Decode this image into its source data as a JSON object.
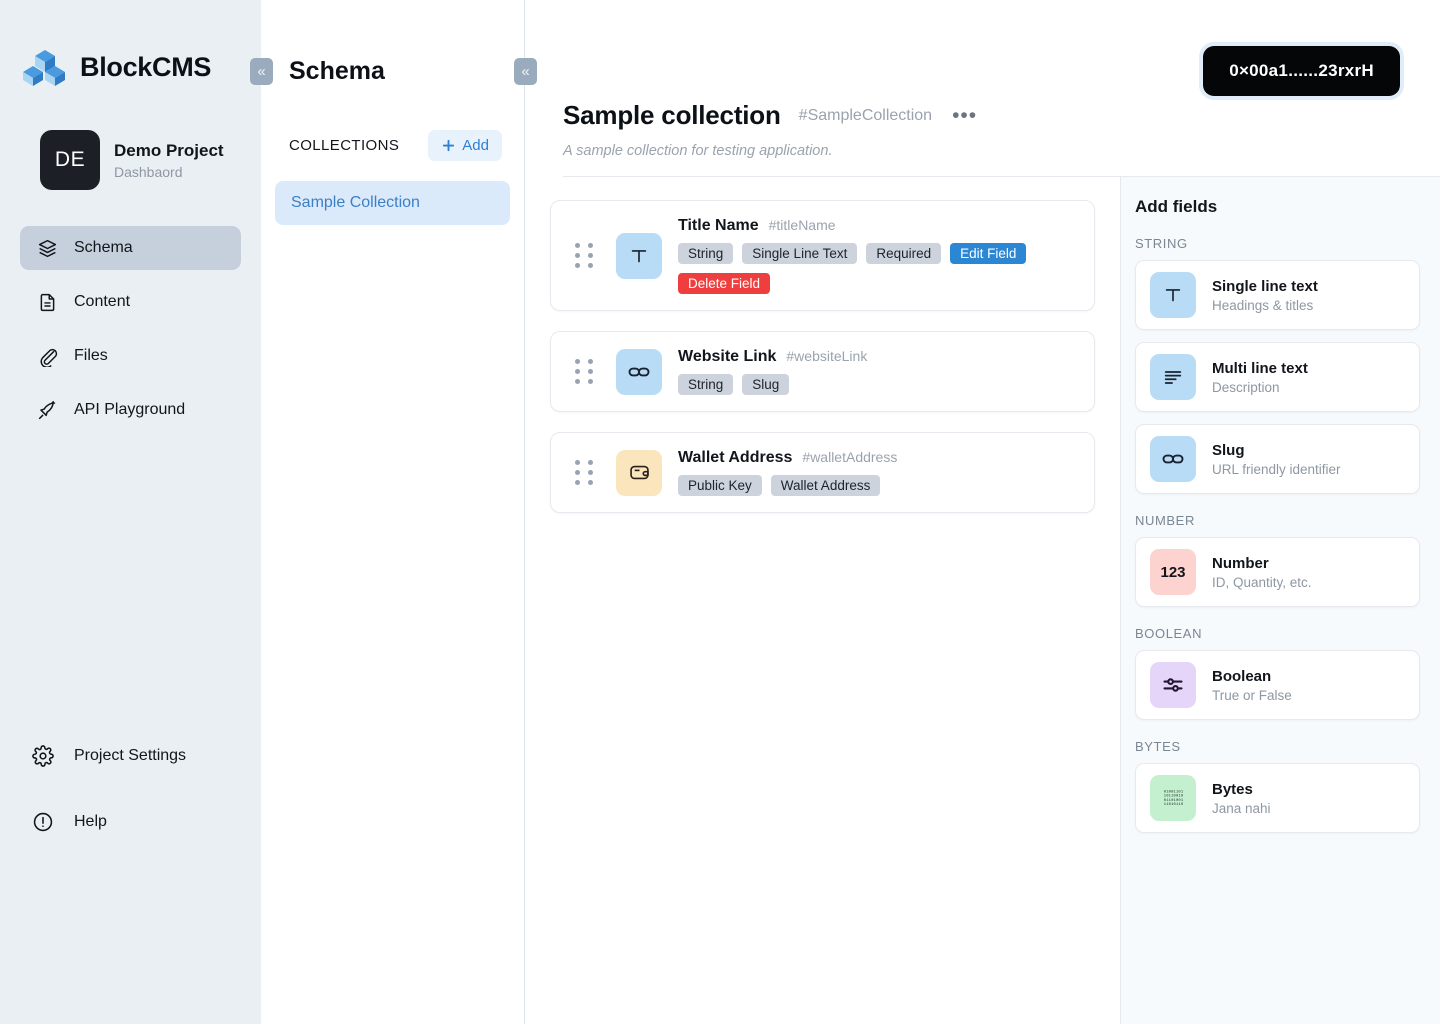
{
  "brand": {
    "name": "BlockCMS",
    "logo_icon": "cubes-logo-icon"
  },
  "project": {
    "initials": "DE",
    "name": "Demo Project",
    "subtitle": "Dashbaord"
  },
  "sidebar": {
    "collapse_icon": "«",
    "items": [
      {
        "label": "Schema",
        "icon": "layers-icon",
        "active": true
      },
      {
        "label": "Content",
        "icon": "document-icon",
        "active": false
      },
      {
        "label": "Files",
        "icon": "paperclip-icon",
        "active": false
      },
      {
        "label": "API Playground",
        "icon": "rocket-icon",
        "active": false
      }
    ],
    "bottom_items": [
      {
        "label": "Project Settings",
        "icon": "gear-icon"
      },
      {
        "label": "Help",
        "icon": "info-circle-icon"
      }
    ]
  },
  "schema_panel": {
    "title": "Schema",
    "collapse_icon": "«",
    "collections_label": "COLLECTIONS",
    "add_label": "Add",
    "add_icon": "plus-icon",
    "collections": [
      {
        "label": "Sample Collection",
        "selected": true
      }
    ]
  },
  "header": {
    "title": "Sample collection",
    "slug": "#SampleCollection",
    "menu_icon": "•••",
    "description": "A sample collection for testing application."
  },
  "wallet": {
    "address": "0×00a1......23rxrH"
  },
  "fields": [
    {
      "name": "Title Name",
      "slug": "#titleName",
      "icon": "text-t-icon",
      "icon_glyph": "T",
      "icon_color": "ico-blue",
      "tags": [
        "String",
        "Single Line Text",
        "Required"
      ],
      "edit_label": "Edit Field",
      "delete_label": "Delete Field",
      "has_actions": true
    },
    {
      "name": "Website Link",
      "slug": "#websiteLink",
      "icon": "link-icon",
      "icon_glyph": "",
      "icon_color": "ico-blue",
      "tags": [
        "String",
        "Slug"
      ],
      "has_actions": false
    },
    {
      "name": "Wallet Address",
      "slug": "#walletAddress",
      "icon": "wallet-icon",
      "icon_glyph": "",
      "icon_color": "ico-amber",
      "tags": [
        "Public Key",
        "Wallet Address"
      ],
      "has_actions": false
    }
  ],
  "add_fields": {
    "title": "Add fields",
    "groups": [
      {
        "label": "STRING",
        "items": [
          {
            "name": "Single line text",
            "desc": "Headings & titles",
            "icon": "text-t-icon",
            "glyph": "T",
            "color": "blue"
          },
          {
            "name": "Multi line text",
            "desc": "Description",
            "icon": "text-lines-icon",
            "glyph": "",
            "color": "blue"
          },
          {
            "name": "Slug",
            "desc": "URL friendly identifier",
            "icon": "link-icon",
            "glyph": "",
            "color": "blue"
          }
        ]
      },
      {
        "label": "NUMBER",
        "items": [
          {
            "name": "Number",
            "desc": "ID, Quantity, etc.",
            "icon": "number-123-icon",
            "glyph": "123",
            "color": "pink"
          }
        ]
      },
      {
        "label": "BOOLEAN",
        "items": [
          {
            "name": "Boolean",
            "desc": "True or False",
            "icon": "sliders-icon",
            "glyph": "",
            "color": "purple"
          }
        ]
      },
      {
        "label": "BYTES",
        "items": [
          {
            "name": "Bytes",
            "desc": "Jana nahi",
            "icon": "binary-grid-icon",
            "glyph": "",
            "color": "green"
          }
        ]
      }
    ]
  },
  "colors": {
    "sidebar_bg": "#eaeff4",
    "accent_blue": "#2b86d4",
    "danger_red": "#ef3e3e",
    "collection_bg": "#dbeafb",
    "badge_bg": "#050608"
  }
}
